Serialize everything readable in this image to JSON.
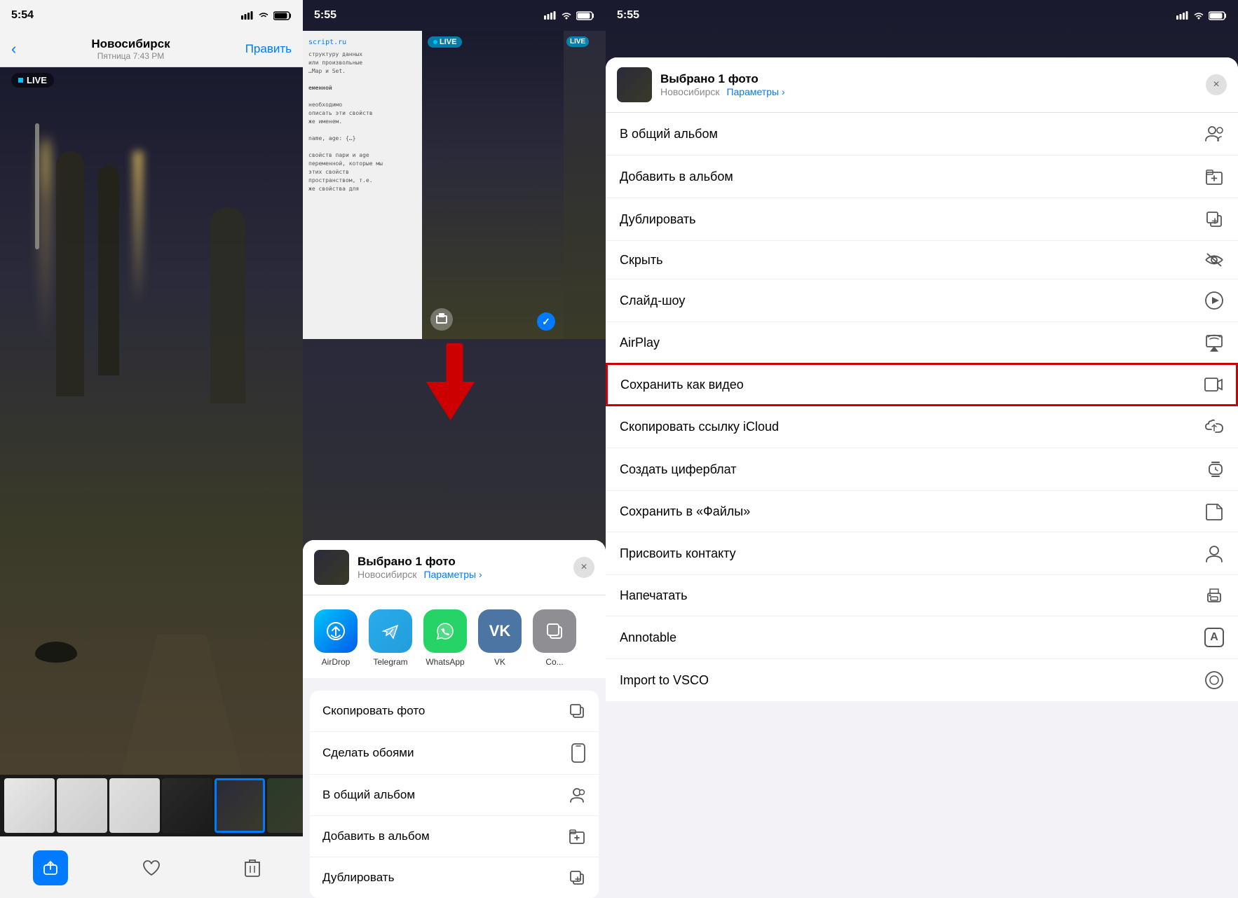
{
  "panel1": {
    "status": {
      "time": "5:54",
      "location_arrow": "▶"
    },
    "nav": {
      "back_icon": "‹",
      "city": "Новосибирск",
      "date": "Пятница  7:43 PM",
      "edit_label": "Править"
    },
    "live_label": "LIVE",
    "thumbnails": [
      {
        "id": 1,
        "type": "screen"
      },
      {
        "id": 2,
        "type": "screen"
      },
      {
        "id": 3,
        "type": "screen"
      },
      {
        "id": 4,
        "type": "dark"
      },
      {
        "id": 5,
        "type": "park",
        "selected": true
      },
      {
        "id": 6,
        "type": "park"
      },
      {
        "id": 7,
        "type": "map"
      }
    ],
    "toolbar": {
      "share_label": "share",
      "like_label": "heart",
      "delete_label": "trash"
    }
  },
  "panel2": {
    "status": {
      "time": "5:55",
      "location_arrow": "▶"
    },
    "share_header": {
      "title": "Выбрано 1 фото",
      "subtitle": "Новосибирск",
      "params_label": "Параметры ›",
      "close_label": "×"
    },
    "apps": [
      {
        "id": "airdrop",
        "label": "AirDrop",
        "icon": "📡"
      },
      {
        "id": "telegram",
        "label": "Telegram",
        "icon": "✈"
      },
      {
        "id": "whatsapp",
        "label": "WhatsApp",
        "icon": "💬"
      },
      {
        "id": "vk",
        "label": "VK",
        "icon": "В"
      },
      {
        "id": "copy",
        "label": "Co...",
        "icon": "📋"
      }
    ],
    "actions": [
      {
        "id": "copy-photo",
        "label": "Скопировать фото",
        "icon": "⎘"
      },
      {
        "id": "wallpaper",
        "label": "Сделать обоями",
        "icon": "📱"
      },
      {
        "id": "shared-album",
        "label": "В общий альбом",
        "icon": "🗂"
      },
      {
        "id": "add-album",
        "label": "Добавить в альбом",
        "icon": "📁"
      },
      {
        "id": "duplicate",
        "label": "Дублировать",
        "icon": "⊕"
      }
    ]
  },
  "panel3": {
    "status": {
      "time": "5:55",
      "location_arrow": "▶"
    },
    "share_header": {
      "title": "Выбрано 1 фото",
      "subtitle": "Новосибирск",
      "params_label": "Параметры ›",
      "close_label": "×"
    },
    "menu_items": [
      {
        "id": "shared-album",
        "label": "В общий альбом",
        "icon": "👤"
      },
      {
        "id": "add-album",
        "label": "Добавить в альбом",
        "icon": "📁"
      },
      {
        "id": "duplicate",
        "label": "Дублировать",
        "icon": "⊕"
      },
      {
        "id": "hide",
        "label": "Скрыть",
        "icon": "👁"
      },
      {
        "id": "slideshow",
        "label": "Слайд-шоу",
        "icon": "▶"
      },
      {
        "id": "airplay",
        "label": "AirPlay",
        "icon": "⬛"
      },
      {
        "id": "save-video",
        "label": "Сохранить как видео",
        "icon": "📹",
        "highlighted": true
      },
      {
        "id": "copy-icloud",
        "label": "Скопировать ссылку iCloud",
        "icon": "🔗"
      },
      {
        "id": "watch-face",
        "label": "Создать циферблат",
        "icon": "⌚"
      },
      {
        "id": "save-files",
        "label": "Сохранить в «Файлы»",
        "icon": "📂"
      },
      {
        "id": "assign-contact",
        "label": "Присвоить контакту",
        "icon": "👤"
      },
      {
        "id": "print",
        "label": "Напечатать",
        "icon": "🖨"
      },
      {
        "id": "annotable",
        "label": "Annotable",
        "icon": "A"
      },
      {
        "id": "import-vsco",
        "label": "Import to VSCO",
        "icon": "◯"
      }
    ]
  }
}
